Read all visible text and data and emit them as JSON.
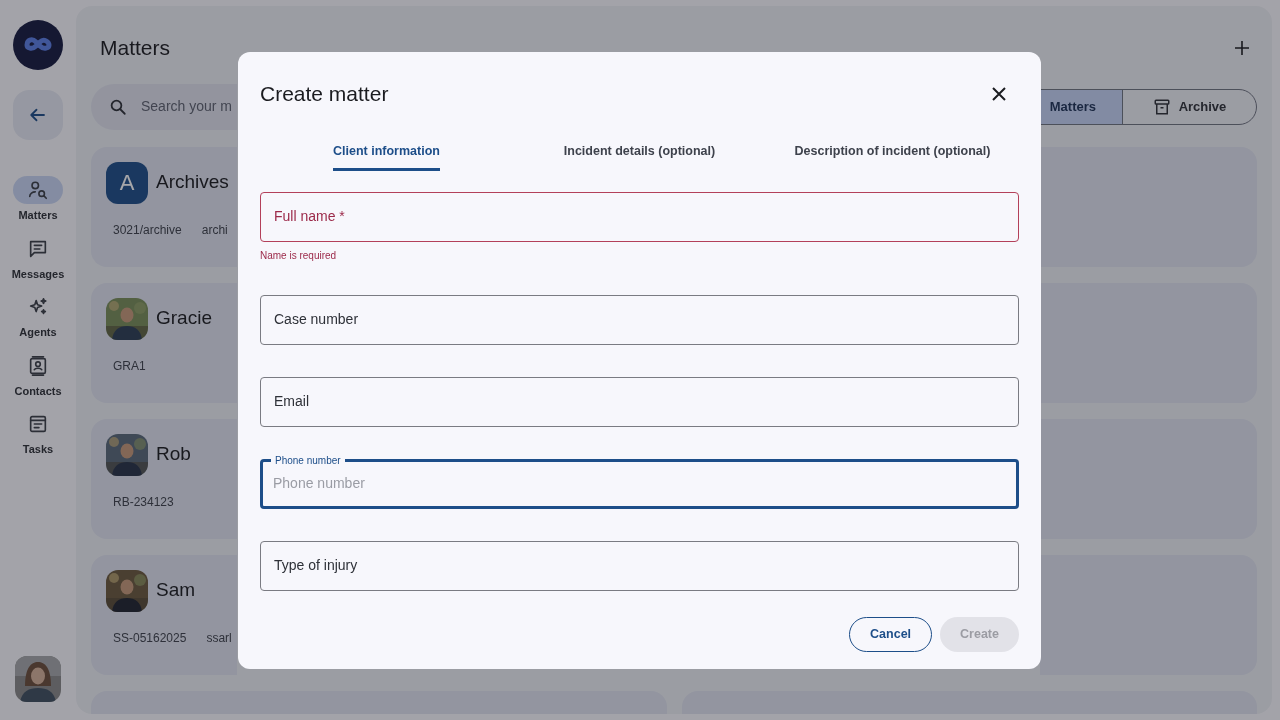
{
  "rail": {
    "items": [
      {
        "label": "Matters",
        "selected": true
      },
      {
        "label": "Messages",
        "selected": false
      },
      {
        "label": "Agents",
        "selected": false
      },
      {
        "label": "Contacts",
        "selected": false
      },
      {
        "label": "Tasks",
        "selected": false
      }
    ]
  },
  "page": {
    "title": "Matters",
    "search": {
      "placeholder": "Search your m"
    },
    "views": [
      {
        "label": "Matters",
        "selected": true
      },
      {
        "label": "Archive",
        "selected": false
      }
    ]
  },
  "matters": [
    {
      "kind": "letter",
      "initial": "A",
      "name": "Archives",
      "tags": [
        "3021/archive",
        "archi"
      ]
    },
    {
      "kind": "picture",
      "name": "Gracie",
      "tags": [
        "GRA1"
      ]
    },
    {
      "kind": "picture",
      "name": "Rob",
      "tags": [
        "RB-234123"
      ]
    },
    {
      "kind": "picture",
      "name": "Sam",
      "tags": [
        "SS-05162025",
        "ssarl"
      ]
    }
  ],
  "dialog": {
    "title": "Create matter",
    "tabs": [
      {
        "label": "Client information",
        "selected": true
      },
      {
        "label": "Incident details (optional)",
        "selected": false
      },
      {
        "label": "Description of incident (optional)",
        "selected": false
      }
    ],
    "fields": [
      {
        "label": "Full name *",
        "focused": false,
        "error": "Name is required"
      },
      {
        "label": "Case number",
        "focused": false
      },
      {
        "label": "Email",
        "focused": false
      },
      {
        "label": "Phone number",
        "focused": true,
        "placeholder": "Phone number"
      },
      {
        "label": "Type of injury",
        "focused": false
      }
    ],
    "buttons": [
      {
        "label": "Cancel",
        "kind": "outlined",
        "disabled": false
      },
      {
        "label": "Create",
        "kind": "filled",
        "disabled": true
      }
    ]
  }
}
